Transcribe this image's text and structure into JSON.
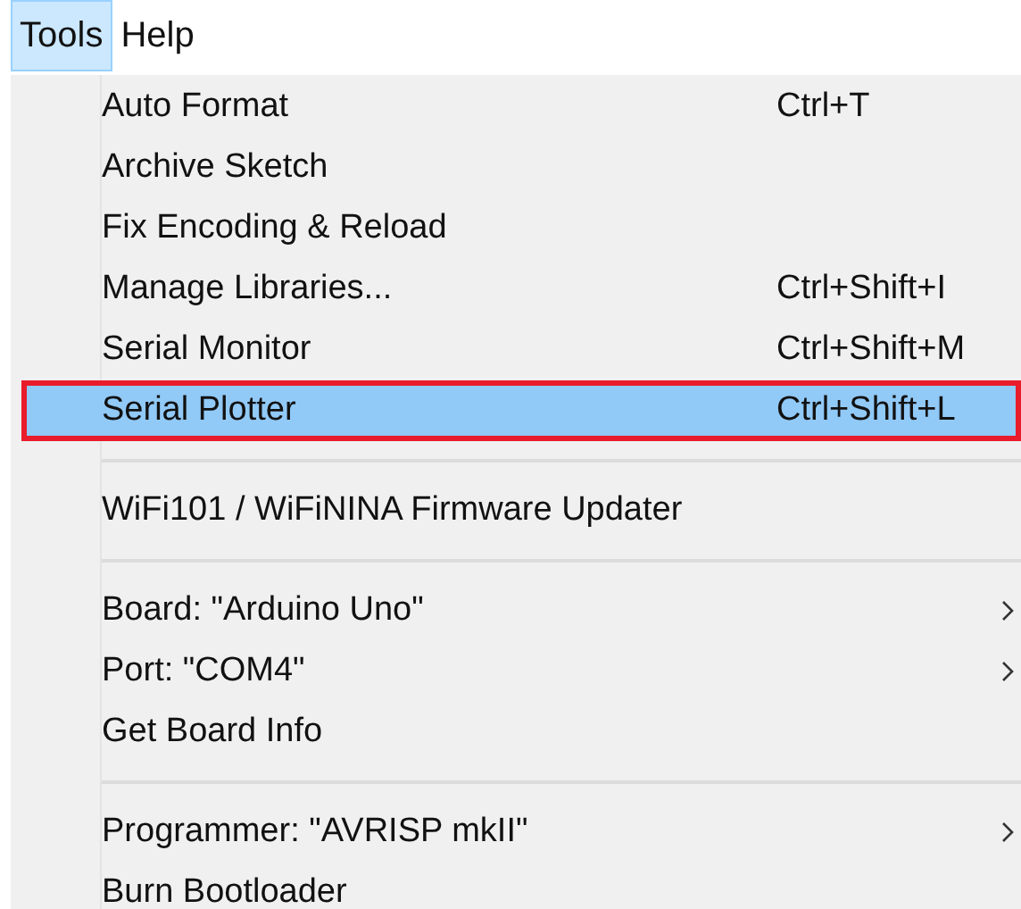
{
  "menubar": [
    {
      "label": "Tools",
      "selected": true
    },
    {
      "label": "Help",
      "selected": false
    }
  ],
  "menu": {
    "groups": [
      {
        "items": [
          {
            "label": "Auto Format",
            "shortcut": "Ctrl+T",
            "submenu": false,
            "selected": false,
            "outlined": false
          },
          {
            "label": "Archive Sketch",
            "submenu": false,
            "selected": false,
            "outlined": false
          },
          {
            "label": "Fix Encoding & Reload",
            "submenu": false,
            "selected": false,
            "outlined": false
          },
          {
            "label": "Manage Libraries...",
            "shortcut": "Ctrl+Shift+I",
            "submenu": false,
            "selected": false,
            "outlined": false
          },
          {
            "label": "Serial Monitor",
            "shortcut": "Ctrl+Shift+M",
            "submenu": false,
            "selected": false,
            "outlined": false
          },
          {
            "label": "Serial Plotter",
            "shortcut": "Ctrl+Shift+L",
            "submenu": false,
            "selected": true,
            "outlined": true
          }
        ]
      },
      {
        "items": [
          {
            "label": "WiFi101 / WiFiNINA Firmware Updater",
            "submenu": false,
            "selected": false,
            "outlined": false
          }
        ]
      },
      {
        "items": [
          {
            "label": "Board: \"Arduino Uno\"",
            "submenu": true,
            "selected": false,
            "outlined": false
          },
          {
            "label": "Port: \"COM4\"",
            "submenu": true,
            "selected": false,
            "outlined": false
          },
          {
            "label": "Get Board Info",
            "submenu": false,
            "selected": false,
            "outlined": false
          }
        ]
      },
      {
        "items": [
          {
            "label": "Programmer: \"AVRISP mkII\"",
            "submenu": true,
            "selected": false,
            "outlined": false
          },
          {
            "label": "Burn Bootloader",
            "submenu": false,
            "selected": false,
            "outlined": false
          }
        ]
      }
    ]
  }
}
